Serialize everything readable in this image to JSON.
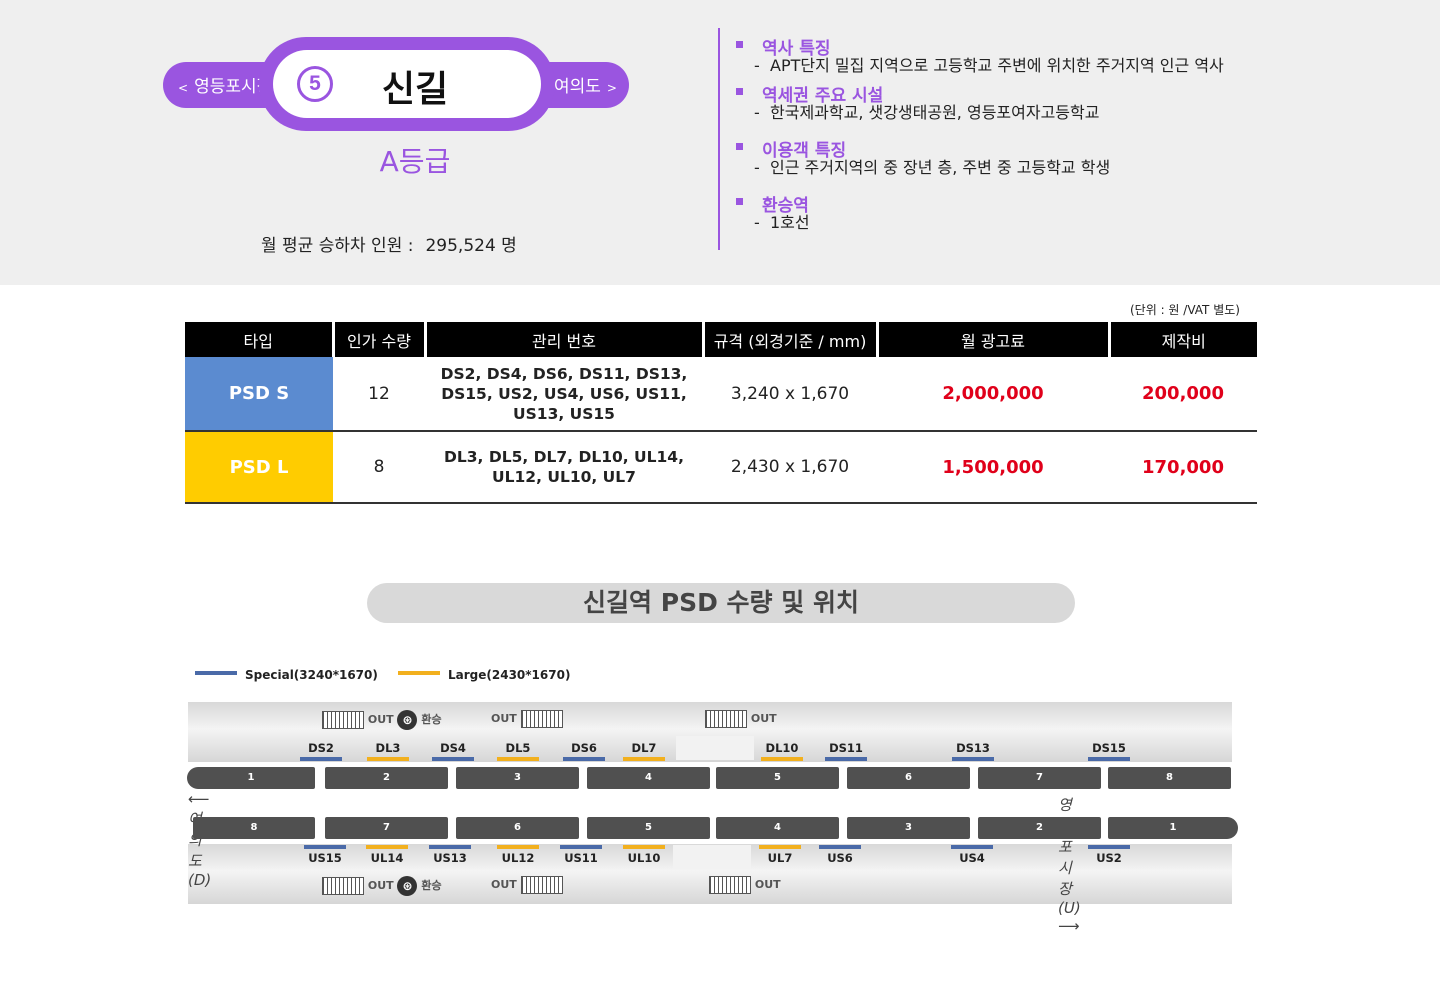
{
  "station": {
    "number": "5",
    "name": "신길",
    "prev": "영등포시장",
    "next": "여의도",
    "grade": "A등급",
    "monthly_label": "월 평균 승하차 인원 :",
    "monthly_value": "295,524 명"
  },
  "info": [
    {
      "title": "역사 특징",
      "detail": "APT단지 밀집 지역으로 고등학교 주변에 위치한 주거지역 인근 역사"
    },
    {
      "title": "역세권 주요 시설",
      "detail": "한국제과학교, 샛강생태공원, 영등포여자고등학교"
    },
    {
      "title": "이용객 특징",
      "detail": "인근 주거지역의 중 장년 층, 주변 중 고등학교 학생"
    },
    {
      "title": "환승역",
      "detail": "1호선"
    }
  ],
  "table": {
    "unit": "(단위 : 원 /VAT 별도)",
    "headers": [
      "타입",
      "인가 수량",
      "관리 번호",
      "규격 (외경기준 / mm)",
      "월 광고료",
      "제작비"
    ],
    "rows": [
      {
        "type": "PSD S",
        "qty": "12",
        "codes": "DS2, DS4, DS6, DS11, DS13, DS15, US2, US4, US6, US11, US13, US15",
        "size": "3,240 x 1,670",
        "fee": "2,000,000",
        "prod": "200,000"
      },
      {
        "type": "PSD L",
        "qty": "8",
        "codes": "DL3, DL5, DL7, DL10, UL14, UL12, UL10, UL7",
        "size": "2,430 x 1,670",
        "fee": "1,500,000",
        "prod": "170,000"
      }
    ]
  },
  "section_title": "신길역  PSD 수량 및 위치",
  "legend": {
    "special": "Special(3240*1670)",
    "large": "Large(2430*1670)"
  },
  "colors": {
    "accent": "#9a55e0",
    "special": "#4a6aa8",
    "large": "#f2b01e",
    "price": "#e0001a"
  },
  "diagram": {
    "top_markers": [
      "DS2",
      "DL3",
      "DS4",
      "DL5",
      "DS6",
      "DL7",
      "DL10",
      "DS11",
      "DS13",
      "DS15"
    ],
    "bottom_markers": [
      "US15",
      "UL14",
      "US13",
      "UL12",
      "US11",
      "UL10",
      "UL7",
      "US6",
      "US4",
      "US2"
    ],
    "top_cars": [
      "1",
      "2",
      "3",
      "4",
      "5",
      "6",
      "7",
      "8"
    ],
    "bottom_cars": [
      "8",
      "7",
      "6",
      "5",
      "4",
      "3",
      "2",
      "1"
    ],
    "dir_down": "여의도(D)",
    "dir_up": "영등포시장(U)",
    "exit_label": "OUT",
    "transfer_label": "환승"
  }
}
